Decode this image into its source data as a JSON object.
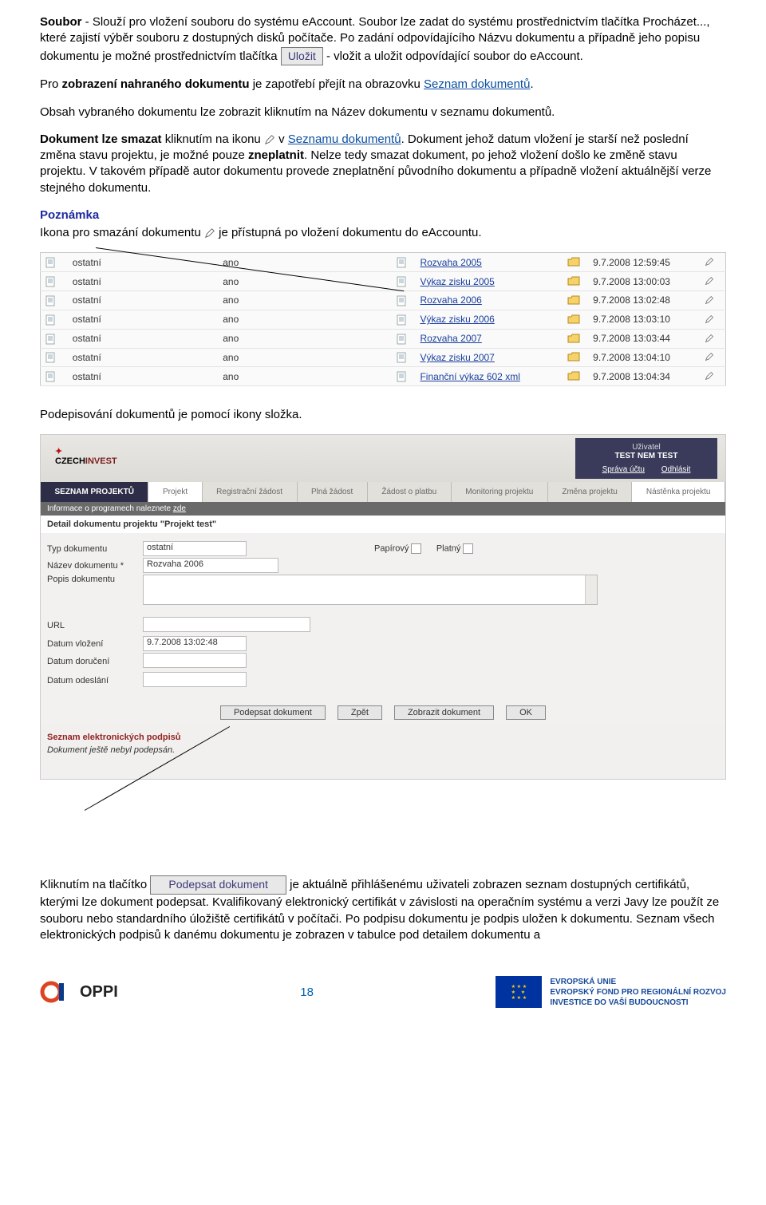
{
  "para1": {
    "a": "Soubor",
    "b": " - Slouží pro vložení souboru do systému eAccount. Soubor lze zadat do systému prostřednictvím tlačítka  Procházet..., které zajistí výběr souboru z dostupných disků počítače. Po zadání odpovídajícího Názvu dokumentu a případně jeho popisu dokumentu  je možné prostřednictvím tlačítka ",
    "btn": "Uložit",
    "c": "- vložit a uložit odpovídající soubor do eAccount."
  },
  "para2": {
    "a": "Pro ",
    "b": "zobrazení nahraného dokumentu",
    "c": " je zapotřebí přejít na obrazovku ",
    "link": "Seznam dokumentů",
    "d": "."
  },
  "para3": "Obsah vybraného dokumentu lze zobrazit kliknutím na Název dokumentu v seznamu dokumentů.",
  "para4": {
    "a": "Dokument lze smazat",
    "b": " kliknutím na ikonu ",
    "c": "v ",
    "link": "Seznamu dokumentů",
    "d": ". Dokument jehož datum vložení je starší než poslední změna stavu projektu, je možné pouze ",
    "e": "zneplatnit",
    "f": ". Nelze tedy smazat dokument, po jehož vložení došlo ke změně stavu projektu. V takovém případě autor dokumentu provede zneplatnění původního dokumentu a případně vložení aktuálnější verze stejného dokumentu."
  },
  "note_title": "Poznámka",
  "note_body_a": "Ikona pro smazání dokumentu ",
  "note_body_b": "je přístupná po vložení dokumentu do eAccountu.",
  "table": {
    "rows": [
      {
        "c1": "ostatní",
        "c2": "ano",
        "name": "Rozvaha 2005",
        "date": "9.7.2008 12:59:45"
      },
      {
        "c1": "ostatní",
        "c2": "ano",
        "name": "Výkaz zisku 2005",
        "date": "9.7.2008 13:00:03"
      },
      {
        "c1": "ostatní",
        "c2": "ano",
        "name": "Rozvaha 2006",
        "date": "9.7.2008 13:02:48"
      },
      {
        "c1": "ostatní",
        "c2": "ano",
        "name": "Výkaz zisku 2006",
        "date": "9.7.2008 13:03:10"
      },
      {
        "c1": "ostatní",
        "c2": "ano",
        "name": "Rozvaha 2007",
        "date": "9.7.2008 13:03:44"
      },
      {
        "c1": "ostatní",
        "c2": "ano",
        "name": "Výkaz zisku 2007",
        "date": "9.7.2008 13:04:10"
      },
      {
        "c1": "ostatní",
        "c2": "ano",
        "name": "Finanční výkaz 602 xml",
        "date": "9.7.2008 13:04:34"
      }
    ]
  },
  "para5": "Podepisování dokumentů je pomocí ikony složka.",
  "app": {
    "logo": "CZECHINVEST",
    "user_label": "Uživatel",
    "user_name": "TEST NEM TEST",
    "acct": "Správa účtu",
    "logout": "Odhlásit",
    "tabs": [
      "SEZNAM PROJEKTŮ",
      "Projekt",
      "Registrační žádost",
      "Plná žádost",
      "Žádost o platbu",
      "Monitoring projektu",
      "Změna projektu",
      "Nástěnka projektu"
    ],
    "infobar_a": "Informace o programech naleznete ",
    "infobar_b": "zde",
    "subtitle": "Detail dokumentu projektu \"Projekt test\"",
    "f_type": "Typ dokumentu",
    "f_type_v": "ostatní",
    "f_name": "Název dokumentu *",
    "f_name_v": "Rozvaha 2006",
    "f_desc": "Popis dokumentu",
    "f_paper": "Papírový",
    "f_valid": "Platný",
    "f_url": "URL",
    "f_date": "Datum vložení",
    "f_date_v": "9.7.2008 13:02:48",
    "f_deliv": "Datum doručení",
    "f_send": "Datum odeslání",
    "btn_sign": "Podepsat dokument",
    "btn_back": "Zpět",
    "btn_show": "Zobrazit dokument",
    "btn_ok": "OK",
    "sig_title": "Seznam elektronických podpisů",
    "sig_note": "Dokument ještě nebyl podepsán."
  },
  "para6": {
    "a": "Kliknutím na tlačítko ",
    "btn": "Podepsat dokument",
    "b": "je aktuálně přihlášenému uživateli zobrazen seznam dostupných certifikátů, kterými lze dokument podepsat. Kvalifikovaný elektronický certifikát v závislosti na operačním systému a verzi Javy lze použít ze souboru nebo standardního úložiště certifikátů v počítači. Po podpisu dokumentu je podpis uložen k dokumentu. Seznam všech elektronických podpisů k danému dokumentu je zobrazen v tabulce pod detailem dokumentu a"
  },
  "footer": {
    "oppi": "OPPI",
    "page": "18",
    "eu1": "EVROPSKÁ UNIE",
    "eu2": "EVROPSKÝ FOND PRO REGIONÁLNÍ ROZVOJ",
    "eu3": "INVESTICE DO VAŠÍ BUDOUCNOSTI"
  }
}
